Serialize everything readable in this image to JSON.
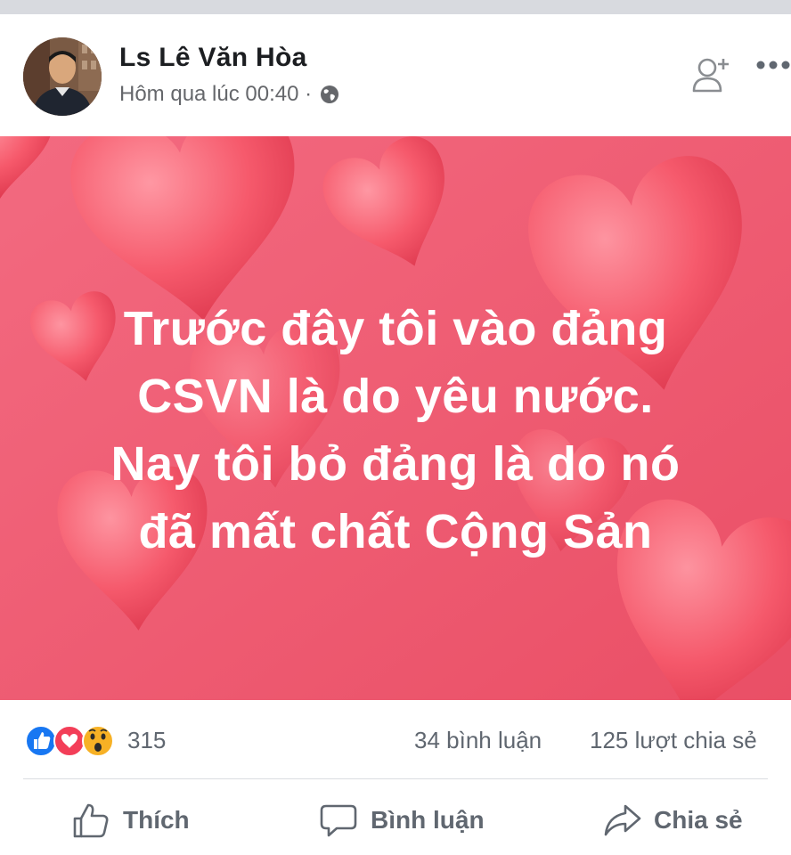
{
  "post": {
    "author": "Ls Lê Văn Hòa",
    "timestamp": "Hôm qua lúc 00:40 ·",
    "privacy_icon": "globe-icon",
    "add_friend_icon": "add-friend-icon",
    "more_icon": "more-options-icon",
    "text_lines": [
      "Trước đây tôi vào đảng",
      "CSVN là do yêu nước.",
      "Nay tôi bỏ đảng là do nó",
      "đã mất chất Cộng Sản"
    ],
    "background_color": "#f05a72"
  },
  "reactions": {
    "icons": [
      "like-reaction-icon",
      "love-reaction-icon",
      "wow-reaction-icon"
    ],
    "count": "315",
    "comments": "34 bình luận",
    "shares": "125 lượt chia sẻ"
  },
  "actions": {
    "like_label": "Thích",
    "comment_label": "Bình luận",
    "share_label": "Chia sẻ"
  },
  "colors": {
    "text_primary": "#1c1e21",
    "text_secondary": "#65676b",
    "like_blue": "#1877f2",
    "love_red": "#f33e58",
    "wow_yellow": "#f7b125"
  }
}
